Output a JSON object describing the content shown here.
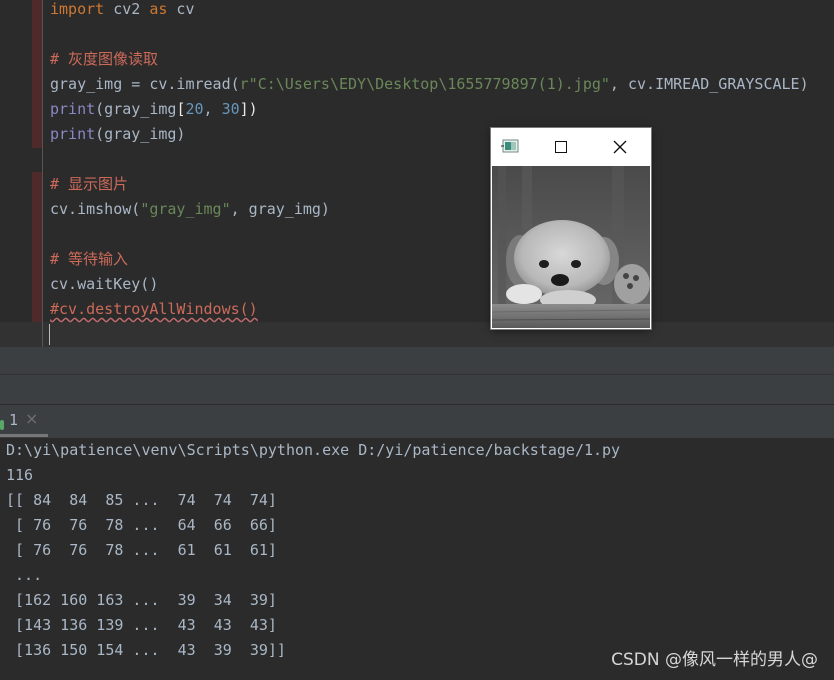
{
  "editor": {
    "code": {
      "import_kw": "import",
      "import_mod": " cv2 ",
      "as_kw": "as",
      "import_alias": " cv",
      "comment_read": "# 灰度图像读取",
      "imread_head": "gray_img = cv.imread(",
      "imread_path": "r\"C:\\Users\\EDY\\Desktop\\1655779897(1).jpg\"",
      "imread_sep": ", ",
      "imread_flag": "cv.IMREAD_GRAYSCALE",
      "imread_tail": ")",
      "print_fn": "print",
      "print1_open": "(gray_img",
      "print1_lbr": "[",
      "print1_n1": "20",
      "print1_sep": ", ",
      "print1_n2": "30",
      "print1_rbr": "])",
      "print2_args": "(gray_img)",
      "comment_show": "# 显示图片",
      "imshow_head": "cv.imshow(",
      "imshow_str": "\"gray_img\"",
      "imshow_tail": ", gray_img)",
      "comment_wait": "# 等待输入",
      "waitkey": "cv.waitKey()",
      "destroy": "#cv.destroyAllWindows()"
    }
  },
  "image_window": {
    "app_icon": "opencv-window-icon",
    "maximize_icon": "maximize-icon",
    "close_icon": "close-icon",
    "image": "grayscale-puppy-photo"
  },
  "run_panel": {
    "tab_label": "1",
    "tab_close": "×",
    "command": "D:\\yi\\patience\\venv\\Scripts\\python.exe D:/yi/patience/backstage/1.py",
    "output": [
      "116",
      "[[ 84  84  85 ...  74  74  74]",
      " [ 76  76  78 ...  64  66  66]",
      " [ 76  76  78 ...  61  61  61]",
      " ...",
      " [162 160 163 ...  39  34  39]",
      " [143 136 139 ...  43  43  43]",
      " [136 150 154 ...  43  39  39]]"
    ]
  },
  "watermark": "CSDN @像风一样的男人@",
  "colors": {
    "editor_bg": "#2b2b2b",
    "keyword": "#cc7832",
    "comment": "#cc6a5a",
    "string": "#6a8759",
    "number": "#6897bb",
    "builtin": "#8888c6",
    "text": "#a9b7c6"
  }
}
